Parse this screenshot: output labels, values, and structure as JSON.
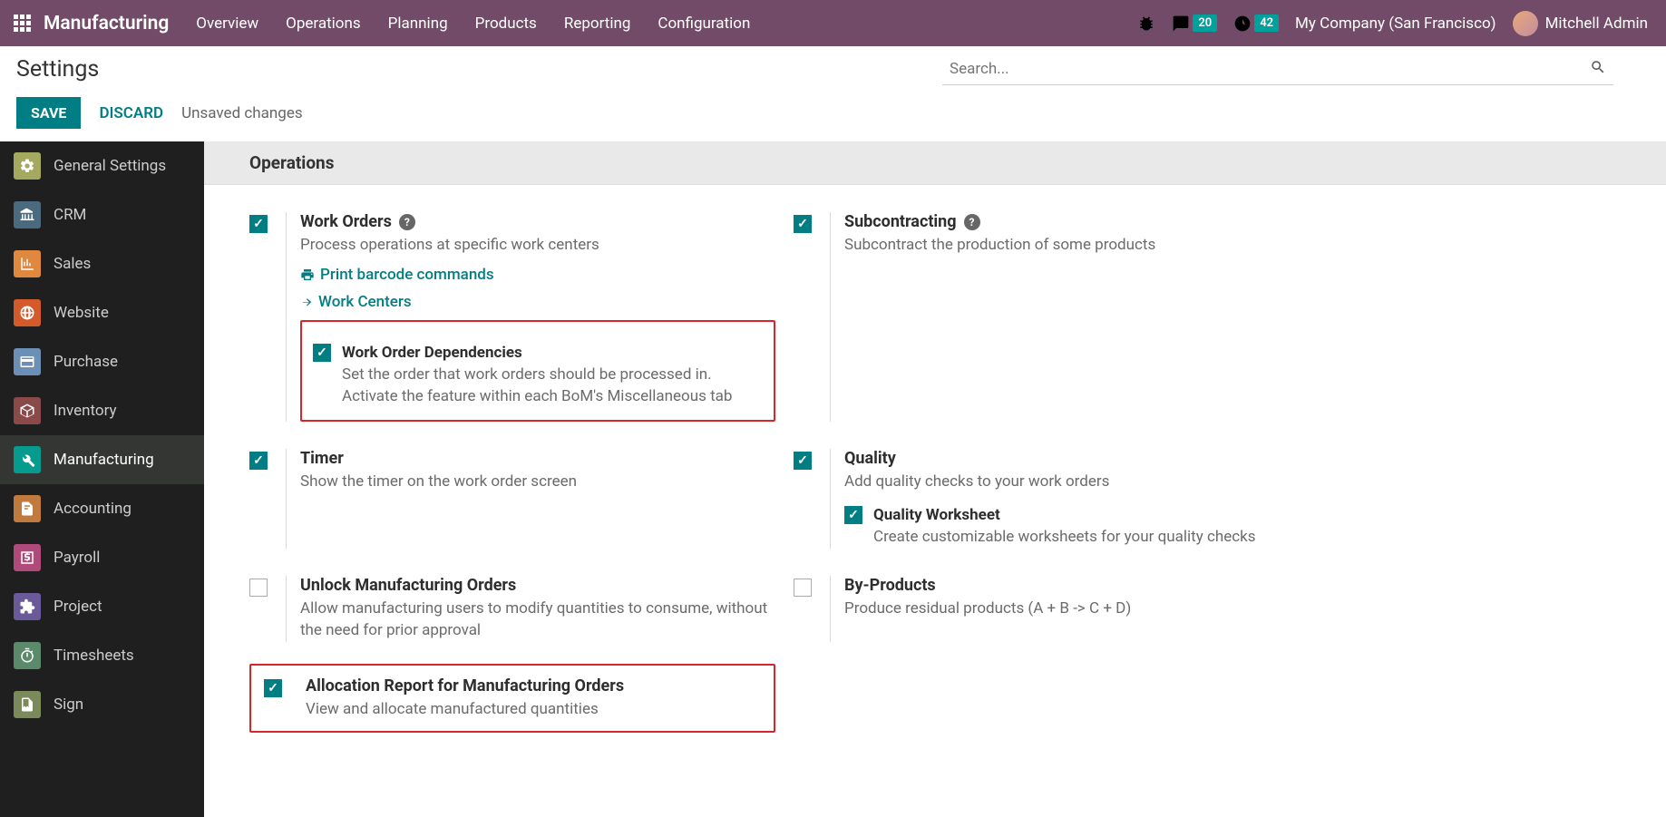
{
  "topnav": {
    "brand": "Manufacturing",
    "menu": [
      "Overview",
      "Operations",
      "Planning",
      "Products",
      "Reporting",
      "Configuration"
    ],
    "chat_count": "20",
    "clock_count": "42",
    "company": "My Company (San Francisco)",
    "user": "Mitchell Admin"
  },
  "header": {
    "title": "Settings",
    "search_placeholder": "Search...",
    "save": "SAVE",
    "discard": "DISCARD",
    "unsaved": "Unsaved changes"
  },
  "sidebar": {
    "items": [
      {
        "label": "General Settings"
      },
      {
        "label": "CRM"
      },
      {
        "label": "Sales"
      },
      {
        "label": "Website"
      },
      {
        "label": "Purchase"
      },
      {
        "label": "Inventory"
      },
      {
        "label": "Manufacturing"
      },
      {
        "label": "Accounting"
      },
      {
        "label": "Payroll"
      },
      {
        "label": "Project"
      },
      {
        "label": "Timesheets"
      },
      {
        "label": "Sign"
      }
    ]
  },
  "section": {
    "title": "Operations"
  },
  "settings": {
    "work_orders": {
      "title": "Work Orders",
      "desc": "Process operations at specific work centers",
      "link1": "Print barcode commands",
      "link2": "Work Centers",
      "sub": {
        "title": "Work Order Dependencies",
        "desc": "Set the order that work orders should be processed in. Activate the feature within each BoM's Miscellaneous tab"
      }
    },
    "subcontracting": {
      "title": "Subcontracting",
      "desc": "Subcontract the production of some products"
    },
    "timer": {
      "title": "Timer",
      "desc": "Show the timer on the work order screen"
    },
    "quality": {
      "title": "Quality",
      "desc": "Add quality checks to your work orders",
      "sub": {
        "title": "Quality Worksheet",
        "desc": "Create customizable worksheets for your quality checks"
      }
    },
    "unlock": {
      "title": "Unlock Manufacturing Orders",
      "desc": "Allow manufacturing users to modify quantities to consume, without the need for prior approval"
    },
    "byproducts": {
      "title": "By-Products",
      "desc": "Produce residual products (A + B -> C + D)"
    },
    "allocation": {
      "title": "Allocation Report for Manufacturing Orders",
      "desc": "View and allocate manufactured quantities"
    }
  }
}
